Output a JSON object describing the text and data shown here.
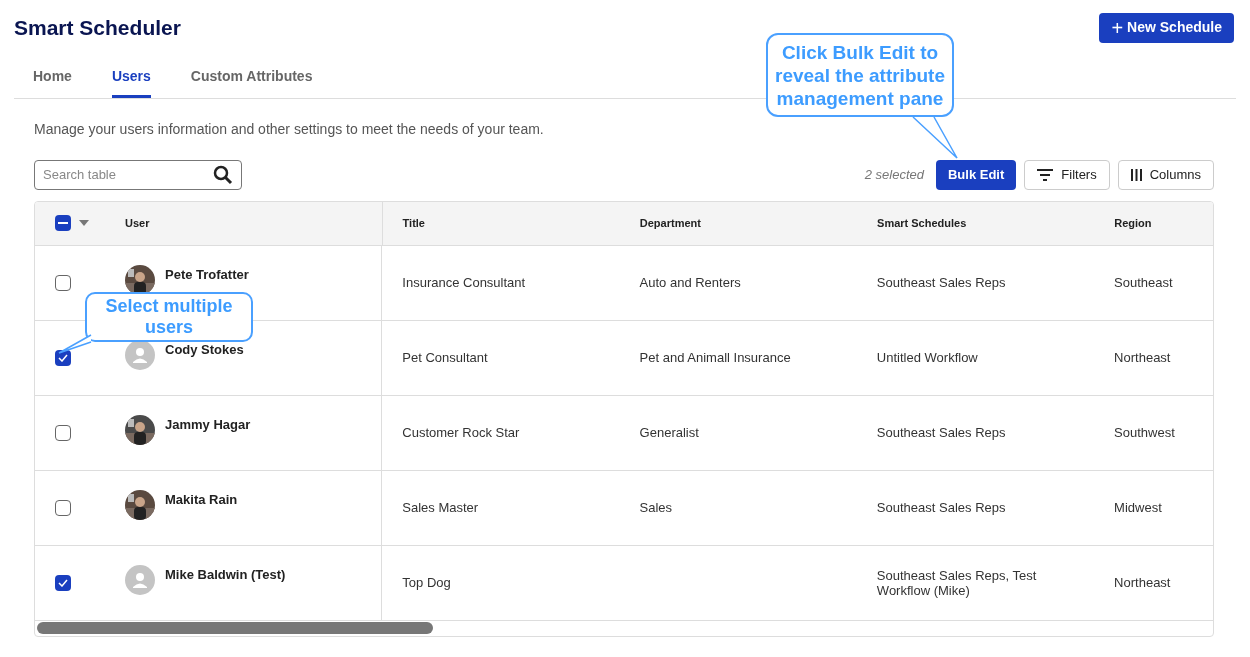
{
  "title": "Smart Scheduler",
  "new_button": {
    "icon": "+",
    "label": "New Schedule"
  },
  "tabs": [
    {
      "label": "Home",
      "selected": false
    },
    {
      "label": "Users",
      "selected": true
    },
    {
      "label": "Custom Attributes",
      "selected": false
    }
  ],
  "description": "Manage your users information and other settings to meet the needs of your team.",
  "search": {
    "placeholder": "Search table"
  },
  "selection_count": "2 selected",
  "toolbar_buttons": [
    {
      "kind": "primary",
      "label": "Bulk Edit"
    },
    {
      "kind": "filters",
      "label": "Filters"
    },
    {
      "kind": "columns",
      "label": "Columns"
    }
  ],
  "table": {
    "select_all": {
      "checked": true,
      "indeterminate": true
    },
    "columns": [
      "User",
      "Title",
      "Department",
      "Smart Schedules",
      "Region"
    ],
    "rows": [
      {
        "checked": false,
        "has_photo": true,
        "user": "Pete Trofatter",
        "title": "Insurance Consultant",
        "department": "Auto and Renters",
        "smart_schedules": "Southeast Sales Reps",
        "region": "Southeast"
      },
      {
        "checked": true,
        "has_photo": false,
        "user": "Cody Stokes",
        "title": "Pet Consultant",
        "department": "Pet and Animall Insurance",
        "smart_schedules": "Untitled Workflow",
        "region": "Northeast"
      },
      {
        "checked": false,
        "has_photo": true,
        "user": "Jammy Hagar",
        "title": "Customer Rock Star",
        "department": "Generalist",
        "smart_schedules": "Southeast Sales Reps",
        "region": "Southwest"
      },
      {
        "checked": false,
        "has_photo": true,
        "user": "Makita Rain",
        "title": "Sales Master",
        "department": "Sales",
        "smart_schedules": "Southeast Sales Reps",
        "region": "Midwest"
      },
      {
        "checked": true,
        "has_photo": false,
        "user": "Mike Baldwin (Test)",
        "title": "Top Dog",
        "smart_schedules": "Southeast Sales Reps, Test Workflow (Mike)",
        "region": "Northeast"
      }
    ]
  },
  "callouts": [
    {
      "text": "Click Bulk Edit to reveal the attribute management pane"
    },
    {
      "text": "Select multiple users"
    }
  ]
}
